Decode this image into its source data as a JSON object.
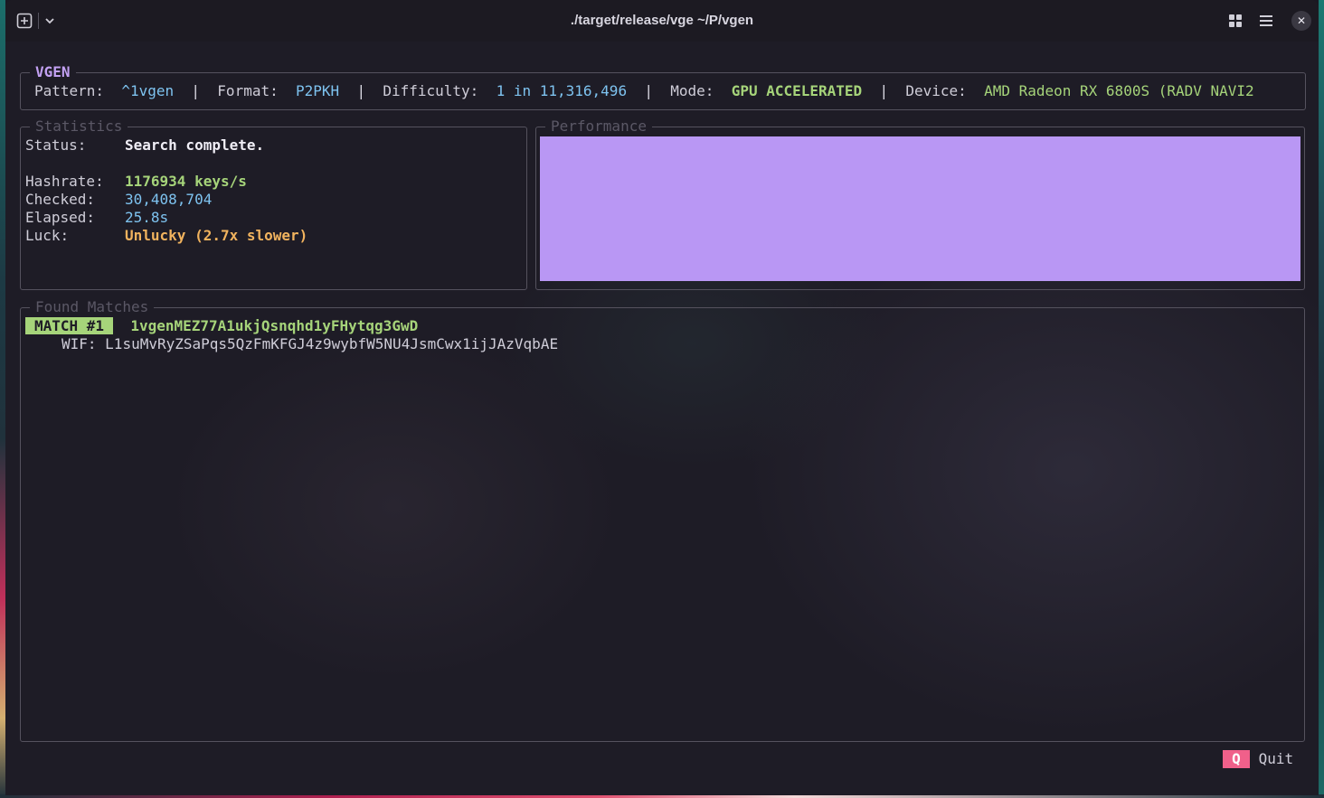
{
  "titlebar": {
    "title": "./target/release/vge ~/P/vgen",
    "new_tab_icon": "plus-square-icon",
    "dropdown_icon": "chevron-down-icon",
    "grid_icon": "grid-icon",
    "menu_icon": "hamburger-menu-icon",
    "close_icon": "close-icon"
  },
  "header": {
    "title": "VGEN",
    "pattern_label": "Pattern:",
    "pattern_value": "^1vgen",
    "format_label": "Format:",
    "format_value": "P2PKH",
    "difficulty_label": "Difficulty:",
    "difficulty_value": "1 in 11,316,496",
    "mode_label": "Mode:",
    "mode_value": "GPU ACCELERATED",
    "device_label": "Device:",
    "device_value": "AMD Radeon RX 6800S (RADV NAVI2",
    "separator": "|"
  },
  "statistics": {
    "title": "Statistics",
    "status_label": "Status:",
    "status_value": "Search complete.",
    "hashrate_label": "Hashrate:",
    "hashrate_value": "1176934 keys/s",
    "checked_label": "Checked:",
    "checked_value": "30,408,704",
    "elapsed_label": "Elapsed:",
    "elapsed_value": "25.8s",
    "luck_label": "Luck:",
    "luck_value": "Unlucky (2.7x slower)"
  },
  "performance": {
    "title": "Performance",
    "fill_fraction": 1.0,
    "fill_color": "#b997f4"
  },
  "matches": {
    "title": "Found Matches",
    "items": [
      {
        "badge": "MATCH #1",
        "address": "1vgenMEZ77A1ukjQsnqhd1yFHytqg3GwD",
        "wif_label": "WIF:",
        "wif_value": "L1suMvRyZSaPqs5QzFmKFGJ4z9wybfW5NU4JsmCwx1ijJAzVqbAE"
      }
    ]
  },
  "footer": {
    "quit_key": "Q",
    "quit_label": "Quit"
  },
  "colors": {
    "accent_purple": "#c3a1f3",
    "accent_green": "#a6d47a",
    "accent_cyan": "#7ec3f0",
    "accent_orange": "#f1b35e",
    "quit_pink": "#f0608a"
  }
}
